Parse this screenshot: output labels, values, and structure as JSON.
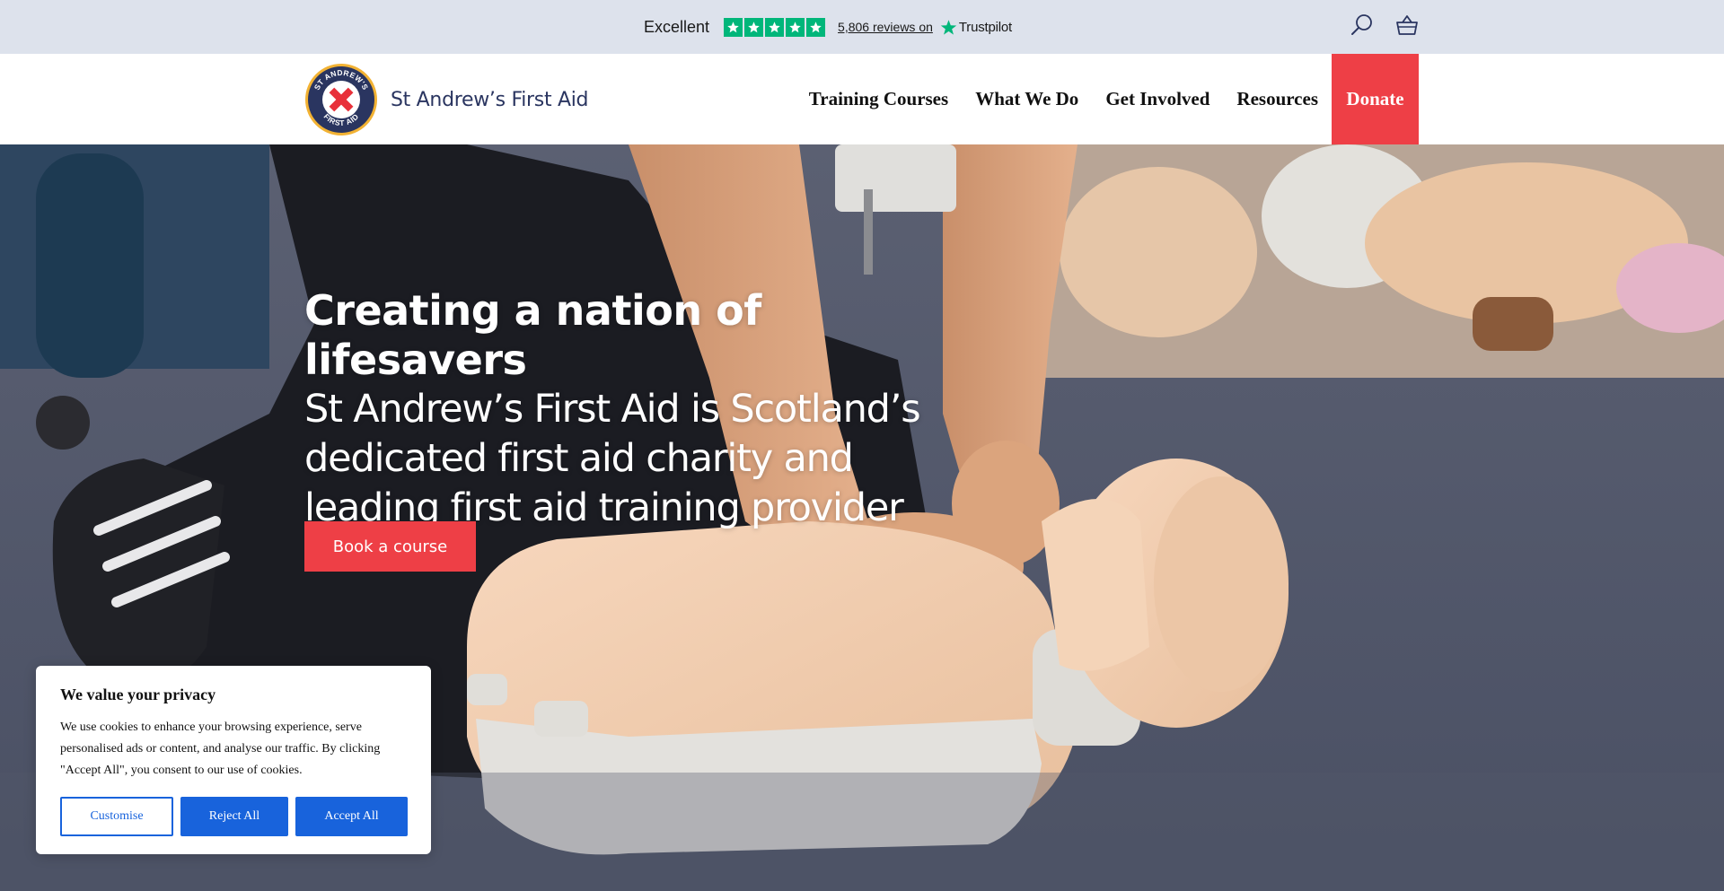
{
  "trustpilot": {
    "rating_label": "Excellent",
    "stars": 5,
    "reviews_link": "5,806 reviews on",
    "brand": "Trustpilot"
  },
  "header_icons": {
    "search": "search-icon",
    "basket": "basket-icon"
  },
  "brand": {
    "logo_badge_top": "ST ANDREW'S",
    "logo_badge_bottom": "FIRST AID",
    "name": "St Andrew’s First Aid"
  },
  "nav": {
    "items": [
      {
        "label": "Training Courses"
      },
      {
        "label": "What We Do"
      },
      {
        "label": "Get Involved"
      },
      {
        "label": "Resources"
      }
    ],
    "donate": "Donate"
  },
  "hero": {
    "title": "Creating a nation of lifesavers",
    "subtitle": "St Andrew’s First Aid is Scotland’s dedicated first aid charity and leading first aid training provider",
    "cta": "Book a course"
  },
  "cookie_banner": {
    "title": "We value your privacy",
    "text": "We use cookies to enhance your browsing experience, serve personalised ads or content, and analyse our traffic. By clicking \"Accept All\", you consent to our use of cookies.",
    "buttons": {
      "customise": "Customise",
      "reject": "Reject All",
      "accept": "Accept All"
    }
  },
  "colors": {
    "topbar_bg": "#dde2ec",
    "trustpilot_green": "#00b67a",
    "brand_navy": "#2a3560",
    "brand_red": "#ee3f46",
    "cookie_blue": "#1863dc"
  }
}
